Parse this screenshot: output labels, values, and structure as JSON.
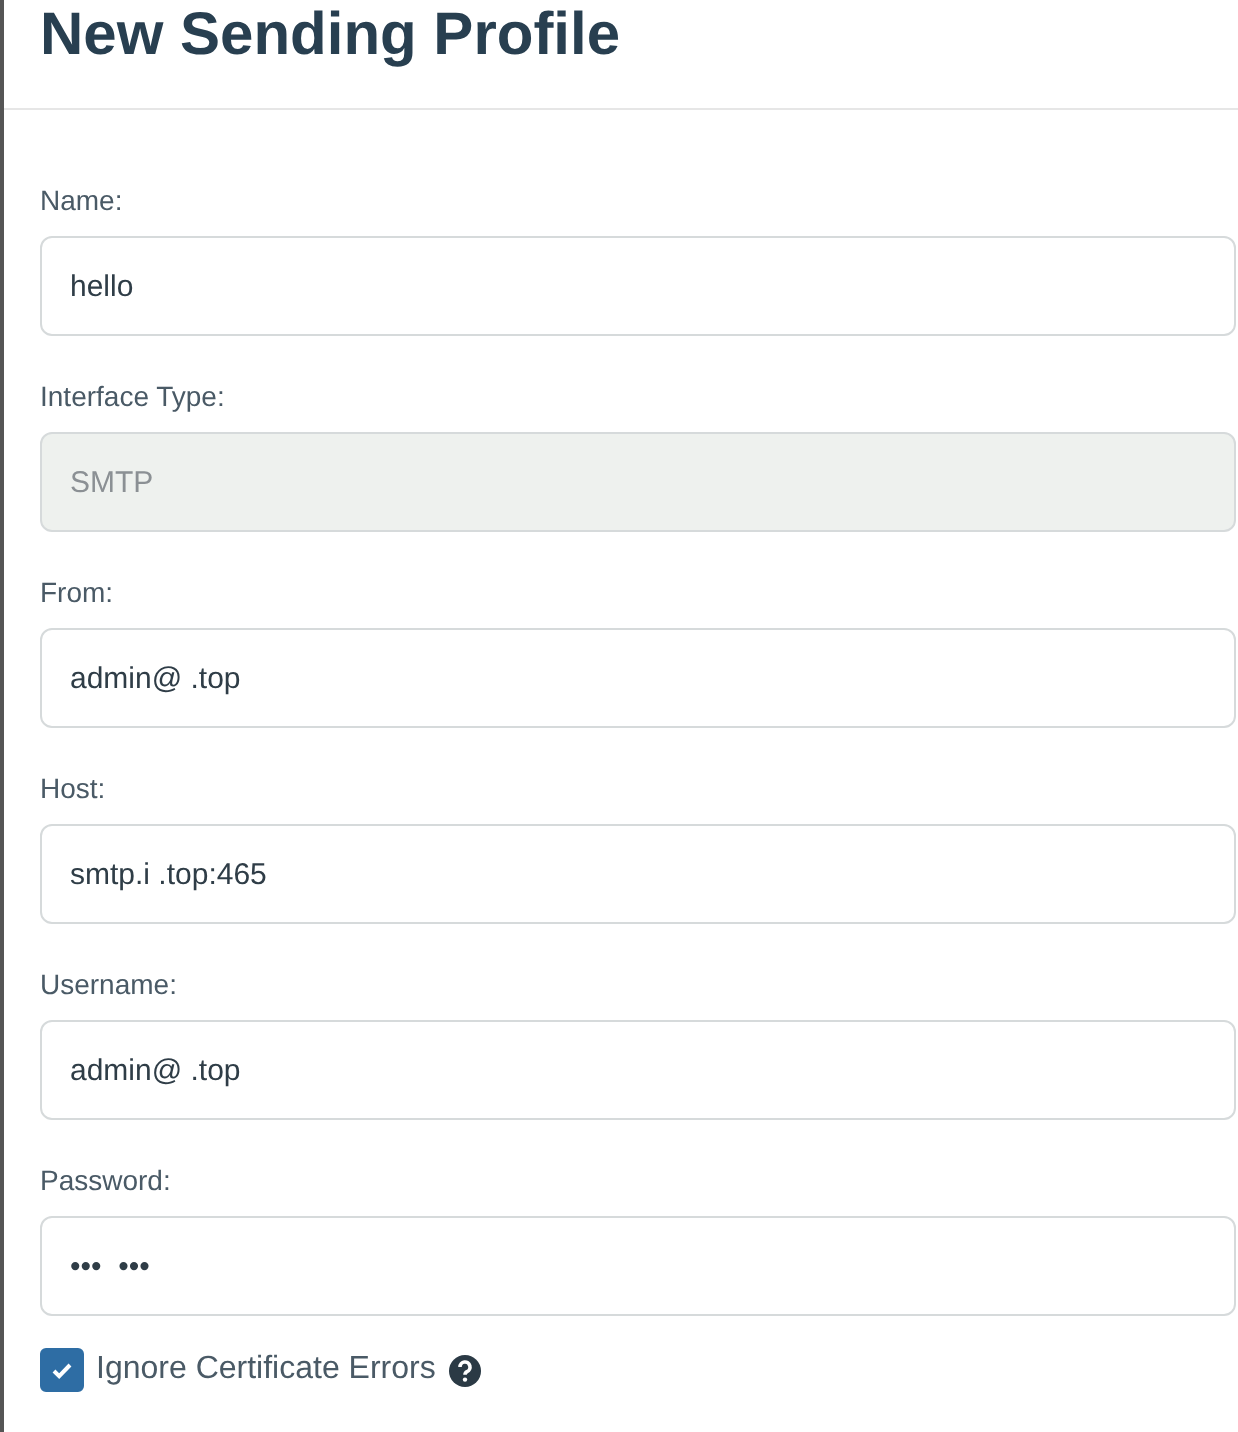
{
  "title": "New Sending Profile",
  "fields": [
    {
      "label": "Name:",
      "value": "hello",
      "disabled": false
    },
    {
      "label": "Interface Type:",
      "value": "SMTP",
      "disabled": true
    },
    {
      "label": "From:",
      "value": "admin@ .top",
      "disabled": false
    },
    {
      "label": "Host:",
      "value": "smtp.i .top:465",
      "disabled": false
    },
    {
      "label": "Username:",
      "value": "admin@ .top",
      "disabled": false
    },
    {
      "label": "Password:",
      "value": "•••  •••",
      "disabled": false
    }
  ],
  "checkbox": {
    "label": "Ignore Certificate Errors",
    "checked": true
  }
}
